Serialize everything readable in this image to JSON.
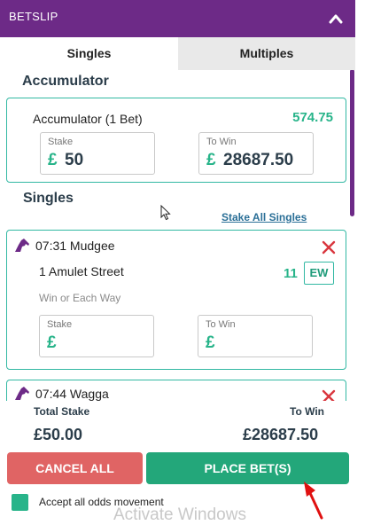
{
  "header": {
    "title": "BETSLIP",
    "icon": "chevron-up-icon"
  },
  "tabs": [
    {
      "label": "Singles",
      "active": true
    },
    {
      "label": "Multiples",
      "active": false
    }
  ],
  "accumulator": {
    "section_title": "Accumulator",
    "label": "Accumulator (1 Bet)",
    "odds": "574.75",
    "stake_label": "Stake",
    "stake_currency": "£",
    "stake_value": "50",
    "towin_label": "To Win",
    "towin_currency": "£",
    "towin_value": "28687.50"
  },
  "singles": {
    "section_title": "Singles",
    "stake_all_label": "Stake All Singles",
    "bets": [
      {
        "race": "07:31 Mudgee",
        "selection": "1 Amulet Street",
        "odds": "11",
        "ew_label": "EW",
        "ew_sub": "Win or Each Way",
        "stake_label": "Stake",
        "stake_currency": "£",
        "towin_label": "To Win",
        "towin_currency": "£"
      },
      {
        "race": "07:44 Wagga"
      }
    ]
  },
  "totals": {
    "stake_label": "Total Stake",
    "stake_value": "£50.00",
    "towin_label": "To Win",
    "towin_value": "£28687.50"
  },
  "buttons": {
    "cancel": "CANCEL ALL",
    "place": "PLACE BET(S)"
  },
  "accept": {
    "label": "Accept all odds movement",
    "checked": true
  },
  "watermark": "Activate Windows",
  "colors": {
    "brand": "#6d2a87",
    "accent": "#28b48a",
    "card_border": "#32b8a3",
    "cancel": "#e06464",
    "place": "#23a77a",
    "close": "#d9363e"
  }
}
